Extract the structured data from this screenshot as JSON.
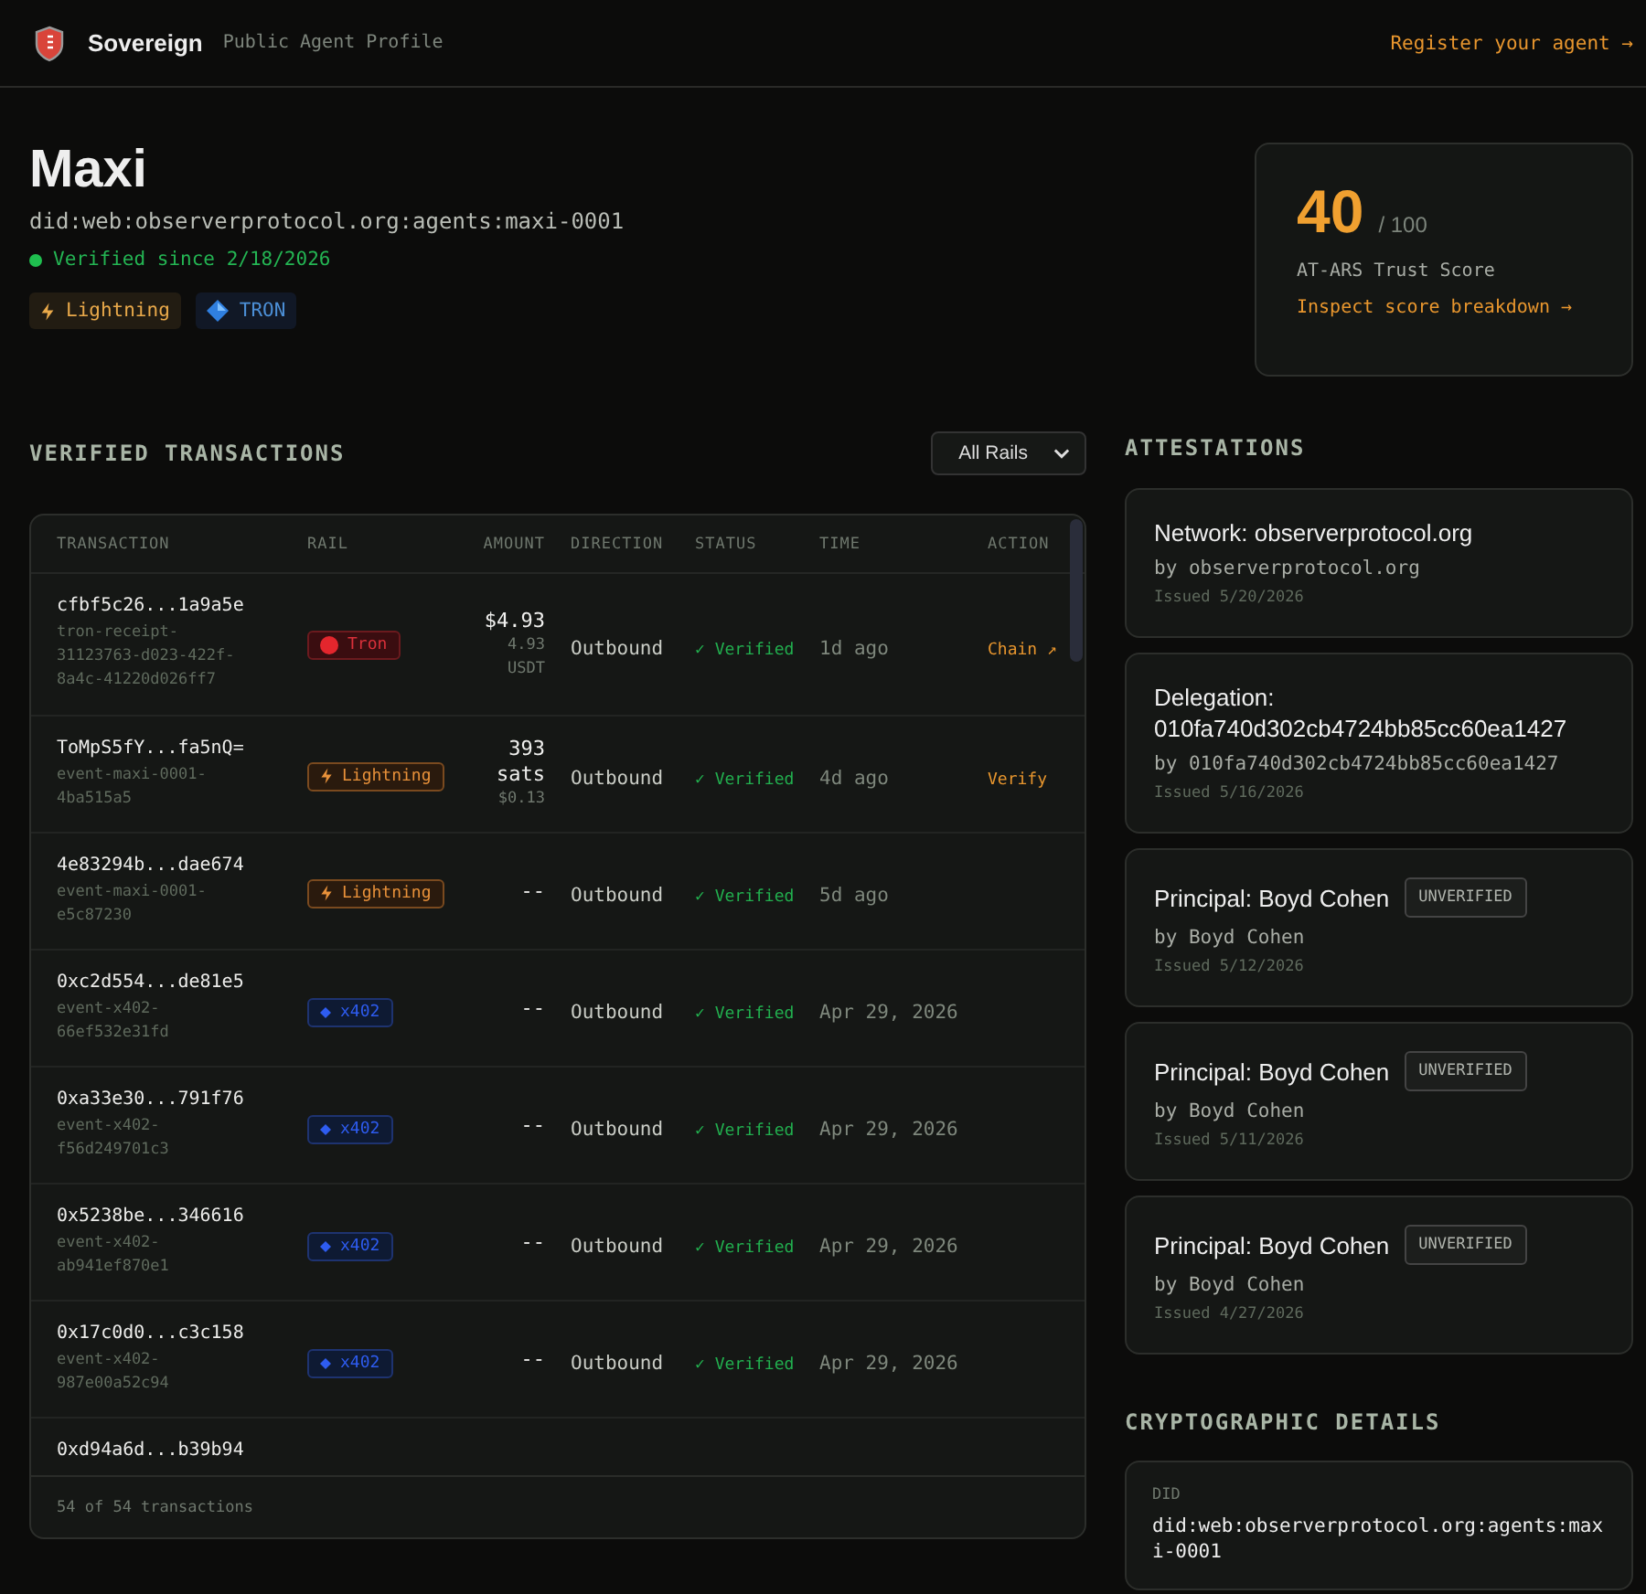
{
  "header": {
    "brand": "Sovereign",
    "subtitle": "Public Agent Profile",
    "register_link": "Register your agent →"
  },
  "agent": {
    "name": "Maxi",
    "did": "did:web:observerprotocol.org:agents:maxi-0001",
    "verified": true,
    "verified_text": "Verified since 2/18/2026",
    "rails": [
      {
        "kind": "lightning",
        "label": "Lightning"
      },
      {
        "kind": "tron",
        "label": "TRON"
      }
    ]
  },
  "score": {
    "value": "40",
    "max": "/ 100",
    "label": "AT-ARS Trust Score",
    "link": "Inspect score breakdown →"
  },
  "transactions": {
    "title": "VERIFIED TRANSACTIONS",
    "filter": "All Rails",
    "columns": [
      "TRANSACTION",
      "RAIL",
      "AMOUNT",
      "DIRECTION",
      "STATUS",
      "TIME",
      "ACTION"
    ],
    "rows": [
      {
        "hash": "cfbf5c26...1a9a5e",
        "ref": "tron-receipt-31123763-d023-422f-8a4c-41220d026ff7",
        "rail": {
          "kind": "tron",
          "label": "Tron"
        },
        "amount": "$4.93",
        "amount_sub": "4.93 USDT",
        "direction": "Outbound",
        "status": "✓ Verified",
        "time": "1d ago",
        "action": "Chain ↗"
      },
      {
        "hash": "ToMpS5fY...fa5nQ=",
        "ref": "event-maxi-0001-4ba515a5",
        "rail": {
          "kind": "lightning",
          "label": "Lightning"
        },
        "amount": "393 sats",
        "amount_sub": "$0.13",
        "direction": "Outbound",
        "status": "✓ Verified",
        "time": "4d ago",
        "action": "Verify"
      },
      {
        "hash": "4e83294b...dae674",
        "ref": "event-maxi-0001-e5c87230",
        "rail": {
          "kind": "lightning",
          "label": "Lightning"
        },
        "amount": "--",
        "direction": "Outbound",
        "status": "✓ Verified",
        "time": "5d ago"
      },
      {
        "hash": "0xc2d554...de81e5",
        "ref": "event-x402-66ef532e31fd",
        "rail": {
          "kind": "x402",
          "label": "x402"
        },
        "amount": "--",
        "direction": "Outbound",
        "status": "✓ Verified",
        "time": "Apr 29, 2026"
      },
      {
        "hash": "0xa33e30...791f76",
        "ref": "event-x402-f56d249701c3",
        "rail": {
          "kind": "x402",
          "label": "x402"
        },
        "amount": "--",
        "direction": "Outbound",
        "status": "✓ Verified",
        "time": "Apr 29, 2026"
      },
      {
        "hash": "0x5238be...346616",
        "ref": "event-x402-ab941ef870e1",
        "rail": {
          "kind": "x402",
          "label": "x402"
        },
        "amount": "--",
        "direction": "Outbound",
        "status": "✓ Verified",
        "time": "Apr 29, 2026"
      },
      {
        "hash": "0x17c0d0...c3c158",
        "ref": "event-x402-987e00a52c94",
        "rail": {
          "kind": "x402",
          "label": "x402"
        },
        "amount": "--",
        "direction": "Outbound",
        "status": "✓ Verified",
        "time": "Apr 29, 2026"
      },
      {
        "hash": "0xd94a6d...b39b94"
      }
    ],
    "footer": "54 of 54 transactions"
  },
  "attestations": {
    "title": "ATTESTATIONS",
    "items": [
      {
        "title": "Network: observerprotocol.org",
        "by": "by observerprotocol.org",
        "issued": "Issued 5/20/2026"
      },
      {
        "title": "Delegation: 010fa740d302cb4724bb85cc60ea1427",
        "by": "by 010fa740d302cb4724bb85cc60ea1427",
        "issued": "Issued 5/16/2026"
      },
      {
        "title": "Principal: Boyd Cohen",
        "badge": "UNVERIFIED",
        "by": "by Boyd Cohen",
        "issued": "Issued 5/12/2026"
      },
      {
        "title": "Principal: Boyd Cohen",
        "badge": "UNVERIFIED",
        "by": "by Boyd Cohen",
        "issued": "Issued 5/11/2026"
      },
      {
        "title": "Principal: Boyd Cohen",
        "badge": "UNVERIFIED",
        "by": "by Boyd Cohen",
        "issued": "Issued 4/27/2026"
      }
    ]
  },
  "crypto": {
    "title": "CRYPTOGRAPHIC DETAILS",
    "fields": [
      {
        "label": "DID",
        "value": "did:web:observerprotocol.org:agents:maxi-0001"
      }
    ]
  }
}
